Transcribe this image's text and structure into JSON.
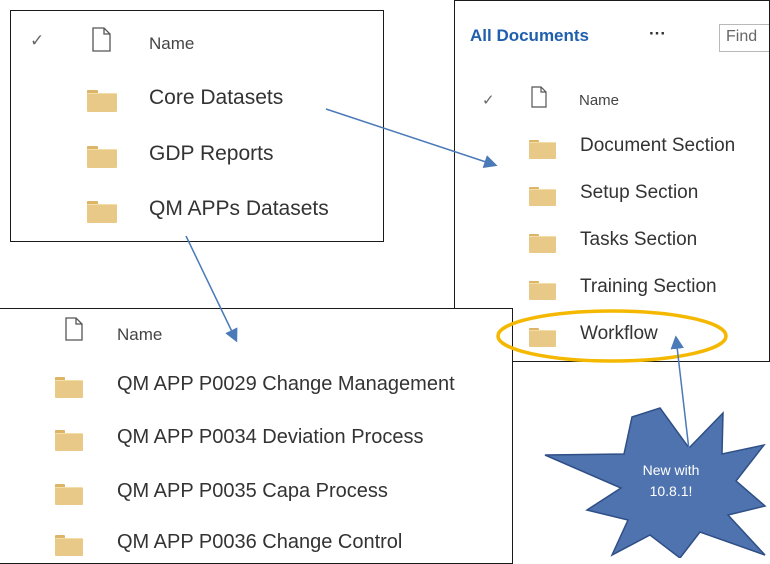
{
  "colors": {
    "arrow": "#4a7ab8",
    "highlight": "#f5b800",
    "burst": "#4f73ae",
    "folder": "#e8c987",
    "link": "#1f5fae"
  },
  "panel_a": {
    "header": {
      "check_icon": "✓",
      "column": "Name"
    },
    "items": [
      "Core Datasets",
      "GDP Reports",
      "QM APPs Datasets"
    ]
  },
  "panel_b": {
    "view_title": "All Documents",
    "more_icon": "···",
    "search_placeholder": "Find",
    "header": {
      "check_icon": "✓",
      "column": "Name"
    },
    "items": [
      "Document Section",
      "Setup Section",
      "Tasks Section",
      "Training Section",
      "Workflow"
    ]
  },
  "panel_c": {
    "header": {
      "column": "Name"
    },
    "items": [
      "QM APP P0029 Change Management",
      "QM APP P0034 Deviation Process",
      "QM APP P0035 Capa Process",
      "QM APP P0036 Change Control"
    ]
  },
  "callout": {
    "line1": "New with",
    "line2": "10.8.1!"
  }
}
